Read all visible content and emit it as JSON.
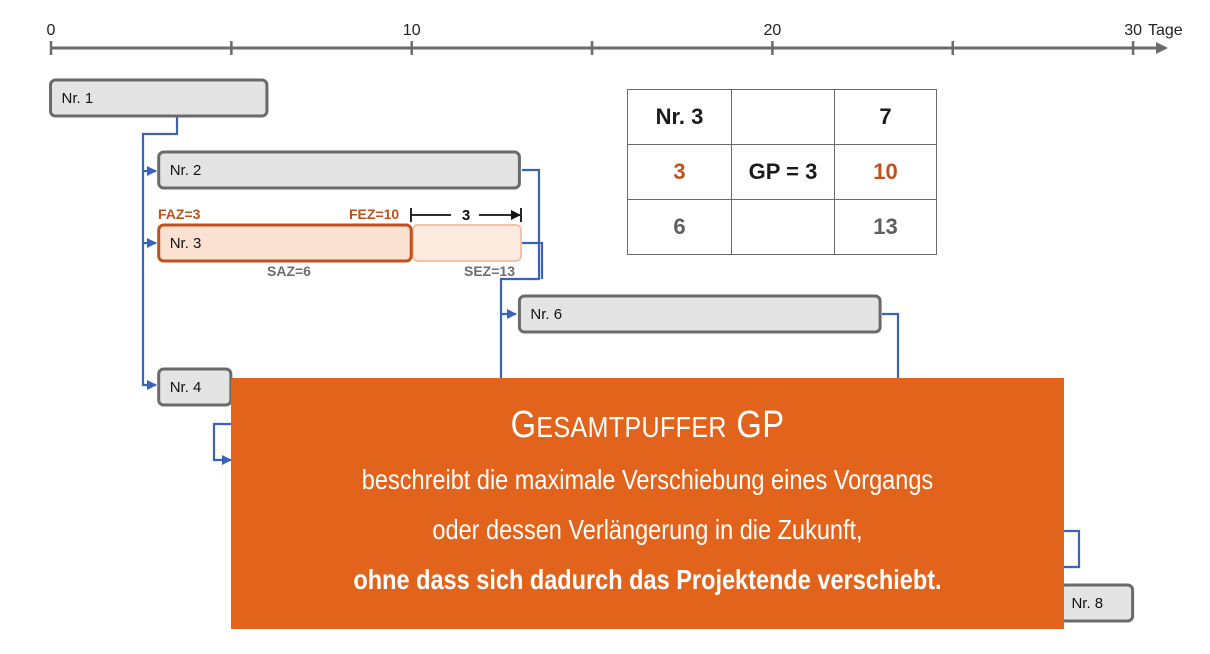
{
  "axis": {
    "ticks": [
      {
        "value": 0,
        "label": "0"
      },
      {
        "value": 5,
        "label": ""
      },
      {
        "value": 10,
        "label": "10"
      },
      {
        "value": 15,
        "label": ""
      },
      {
        "value": 20,
        "label": "20"
      },
      {
        "value": 25,
        "label": ""
      },
      {
        "value": 30,
        "label": "30"
      }
    ],
    "unit": "Tage"
  },
  "bars": [
    {
      "id": "nr1",
      "label": "Nr. 1",
      "start": 0,
      "end": 6,
      "style": "gray",
      "row": 0
    },
    {
      "id": "nr2",
      "label": "Nr. 2",
      "start": 3,
      "end": 13,
      "style": "gray",
      "row": 1
    },
    {
      "id": "nr3",
      "label": "Nr. 3",
      "start": 3,
      "end": 10,
      "style": "orange",
      "row": 2
    },
    {
      "id": "nr6",
      "label": "Nr. 6",
      "start": 13,
      "end": 23,
      "style": "gray",
      "row": 3
    },
    {
      "id": "nr4",
      "label": "Nr. 4",
      "start": 3,
      "end": 5,
      "style": "gray",
      "row": 4
    },
    {
      "id": "nr8",
      "label": "Nr. 8",
      "start": 28,
      "end": 30,
      "style": "gray",
      "row": 5
    }
  ],
  "nr3_labels": {
    "faz": "FAZ=3",
    "fez": "FEZ=10",
    "saz": "SAZ=6",
    "sez": "SEZ=13",
    "buffer": "3"
  },
  "node_table": {
    "name": "Nr. 3",
    "duration": "7",
    "faz": "3",
    "gp": "GP = 3",
    "fez": "10",
    "saz": "6",
    "sez": "13"
  },
  "definition": {
    "title_first": "G",
    "title_rest_small": "ESAMTPUFFER",
    "title_end": " GP",
    "line1": "beschreibt die maximale Verschiebung eines Vorgangs",
    "line2": "oder dessen Verlängerung in die Zukunft,",
    "line3": "ohne dass sich dadurch das Projektende verschiebt."
  },
  "colors": {
    "axis": "#6b6b6b",
    "connector": "#3a63b8",
    "bar_gray_fill": "#e4e4e4",
    "bar_gray_stroke": "#6a6a6a",
    "bar_orange_fill": "#fbe1d2",
    "bar_orange_stroke": "#c0501c",
    "accent_orange": "#e2631b"
  }
}
